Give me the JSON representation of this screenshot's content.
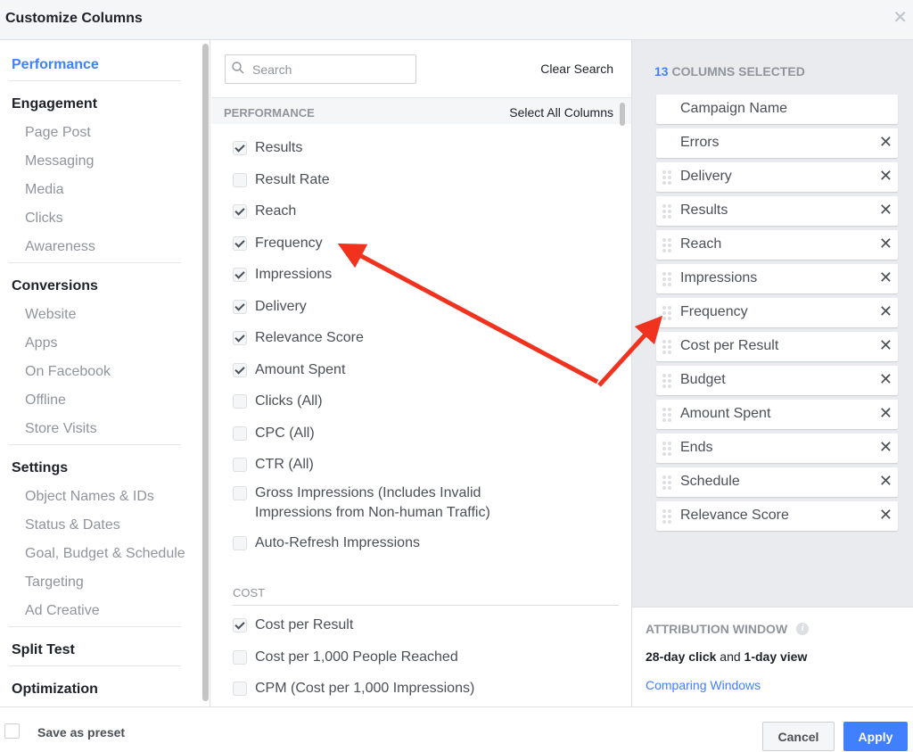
{
  "dialog": {
    "title": "Customize Columns",
    "close_icon": "close-icon"
  },
  "sidebar": {
    "groups": [
      {
        "label": "Performance",
        "active": true,
        "items": []
      },
      {
        "label": "Engagement",
        "items": [
          "Page Post",
          "Messaging",
          "Media",
          "Clicks",
          "Awareness"
        ]
      },
      {
        "label": "Conversions",
        "items": [
          "Website",
          "Apps",
          "On Facebook",
          "Offline",
          "Store Visits"
        ]
      },
      {
        "label": "Settings",
        "items": [
          "Object Names & IDs",
          "Status & Dates",
          "Goal, Budget & Schedule",
          "Targeting",
          "Ad Creative"
        ]
      },
      {
        "label": "Split Test",
        "items": []
      },
      {
        "label": "Optimization",
        "items": []
      }
    ]
  },
  "middle": {
    "search": {
      "placeholder": "Search",
      "value": "",
      "icon": "search-icon"
    },
    "clear_search": "Clear Search",
    "section_label": "PERFORMANCE",
    "select_all": "Select All Columns",
    "performance_items": [
      {
        "label": "Results",
        "checked": true
      },
      {
        "label": "Result Rate",
        "checked": false
      },
      {
        "label": "Reach",
        "checked": true
      },
      {
        "label": "Frequency",
        "checked": true
      },
      {
        "label": "Impressions",
        "checked": true
      },
      {
        "label": "Delivery",
        "checked": true
      },
      {
        "label": "Relevance Score",
        "checked": true
      },
      {
        "label": "Amount Spent",
        "checked": true
      },
      {
        "label": "Clicks (All)",
        "checked": false
      },
      {
        "label": "CPC (All)",
        "checked": false
      },
      {
        "label": "CTR (All)",
        "checked": false
      },
      {
        "label": "Gross Impressions (Includes Invalid Impressions from Non-human Traffic)",
        "checked": false
      },
      {
        "label": "Auto-Refresh Impressions",
        "checked": false
      }
    ],
    "cost_label": "COST",
    "cost_items": [
      {
        "label": "Cost per Result",
        "checked": true
      },
      {
        "label": "Cost per 1,000 People Reached",
        "checked": false
      },
      {
        "label": "CPM (Cost per 1,000 Impressions)",
        "checked": false
      }
    ]
  },
  "right": {
    "count": "13",
    "count_label": "COLUMNS SELECTED",
    "columns": [
      {
        "label": "Campaign Name",
        "draggable": false,
        "removable": false
      },
      {
        "label": "Errors",
        "draggable": false,
        "removable": true
      },
      {
        "label": "Delivery",
        "draggable": true,
        "removable": true
      },
      {
        "label": "Results",
        "draggable": true,
        "removable": true
      },
      {
        "label": "Reach",
        "draggable": true,
        "removable": true
      },
      {
        "label": "Impressions",
        "draggable": true,
        "removable": true
      },
      {
        "label": "Frequency",
        "draggable": true,
        "removable": true
      },
      {
        "label": "Cost per Result",
        "draggable": true,
        "removable": true
      },
      {
        "label": "Budget",
        "draggable": true,
        "removable": true
      },
      {
        "label": "Amount Spent",
        "draggable": true,
        "removable": true
      },
      {
        "label": "Ends",
        "draggable": true,
        "removable": true
      },
      {
        "label": "Schedule",
        "draggable": true,
        "removable": true
      },
      {
        "label": "Relevance Score",
        "draggable": true,
        "removable": true
      }
    ],
    "remove_glyph": "✕"
  },
  "attribution": {
    "heading": "ATTRIBUTION WINDOW",
    "info_glyph": "i",
    "click_window": "28-day click",
    "connector": " and ",
    "view_window": "1-day view",
    "link": "Comparing Windows"
  },
  "footer": {
    "save_preset_label": "Save as preset",
    "save_preset_checked": false,
    "cancel": "Cancel",
    "apply": "Apply"
  },
  "colors": {
    "accent": "#4080ff",
    "annotation_arrow": "#f0321e"
  }
}
